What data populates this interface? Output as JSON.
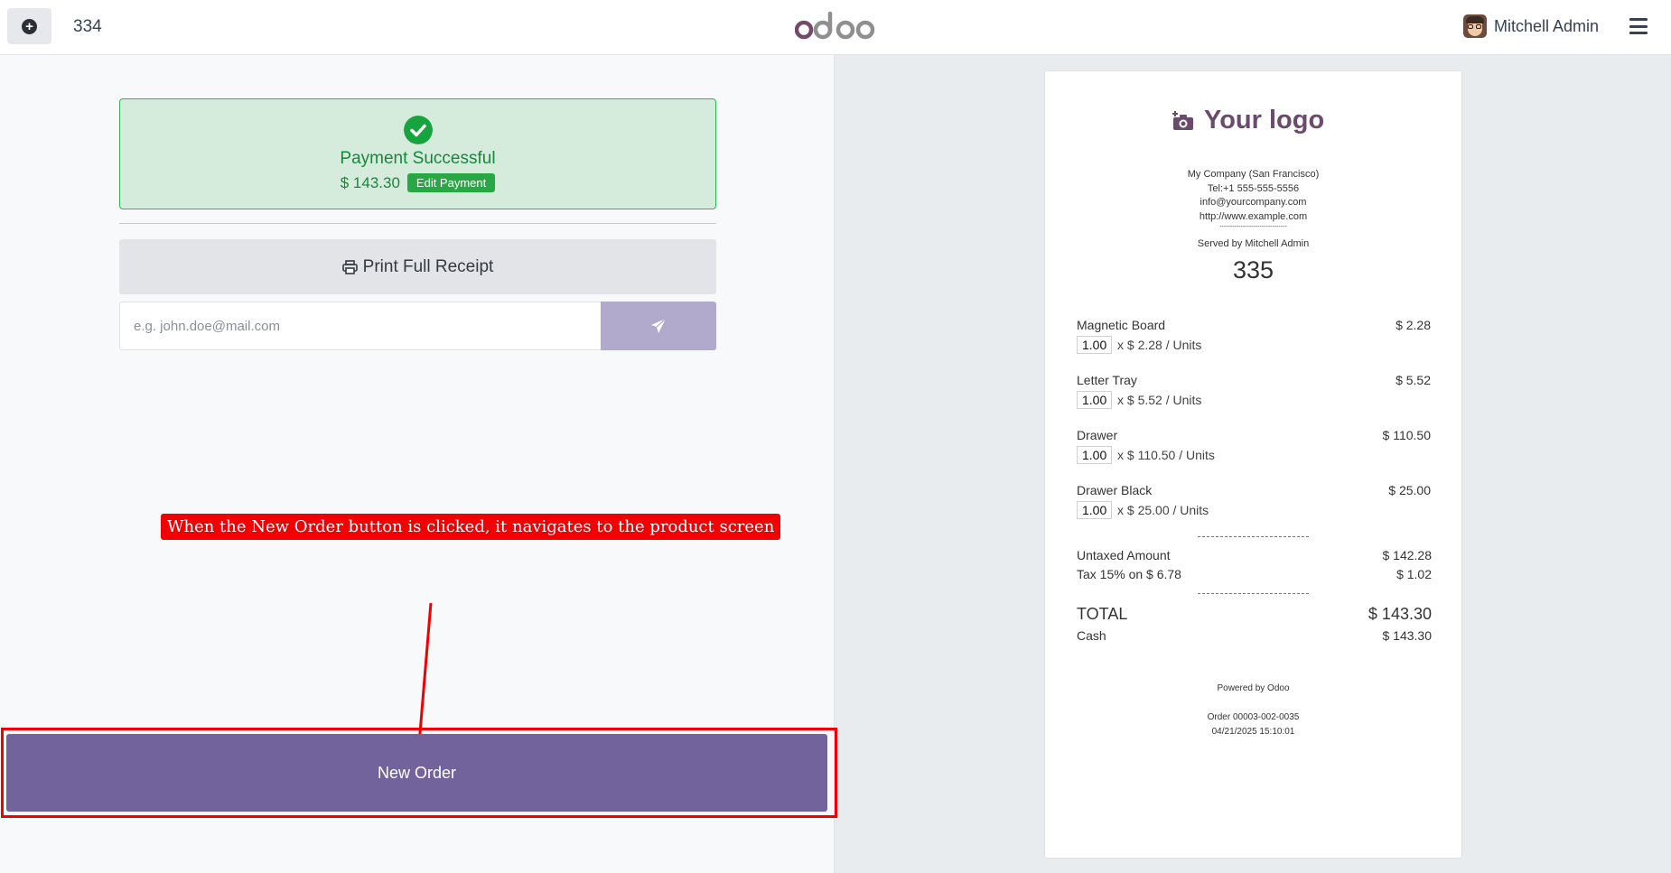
{
  "header": {
    "order_number": "334",
    "logo_text": "odoo",
    "user_name": "Mitchell Admin"
  },
  "payment": {
    "status_title": "Payment Successful",
    "amount": "$ 143.30",
    "edit_label": "Edit Payment"
  },
  "actions": {
    "print_label": "Print Full Receipt",
    "email_placeholder": "e.g. john.doe@mail.com",
    "new_order_label": "New Order"
  },
  "annotation": {
    "text": "When the New Order button is clicked, it navigates to the product screen"
  },
  "receipt": {
    "logo_text": "Your logo",
    "company_lines": [
      "My Company (San Francisco)",
      "Tel:+1 555-555-5556",
      "info@yourcompany.com",
      "http://www.example.com"
    ],
    "company_dashes": "--------------------------------",
    "served_by": "Served by Mitchell Admin",
    "ticket_number": "335",
    "lines": [
      {
        "name": "Magnetic Board",
        "price": "$ 2.28",
        "qty": "1.00",
        "unit": "x $ 2.28 / Units"
      },
      {
        "name": "Letter Tray",
        "price": "$ 5.52",
        "qty": "1.00",
        "unit": "x $ 5.52 / Units"
      },
      {
        "name": "Drawer",
        "price": "$ 110.50",
        "qty": "1.00",
        "unit": "x $ 110.50 / Units"
      },
      {
        "name": "Drawer Black",
        "price": "$ 25.00",
        "qty": "1.00",
        "unit": "x $ 25.00 / Units"
      }
    ],
    "untaxed_label": "Untaxed Amount",
    "untaxed_value": "$ 142.28",
    "tax_label": "Tax 15% on $ 6.78",
    "tax_value": "$ 1.02",
    "total_label": "TOTAL",
    "total_value": "$ 143.30",
    "cash_label": "Cash",
    "cash_value": "$ 143.30",
    "powered_by": "Powered by Odoo",
    "order_ref": "Order 00003-002-0035",
    "order_date": "04/21/2025 15:10:01"
  },
  "colors": {
    "brand": "#714B67",
    "success": "#28a745",
    "primary_button": "#72639c",
    "annotation": "#f00000"
  }
}
